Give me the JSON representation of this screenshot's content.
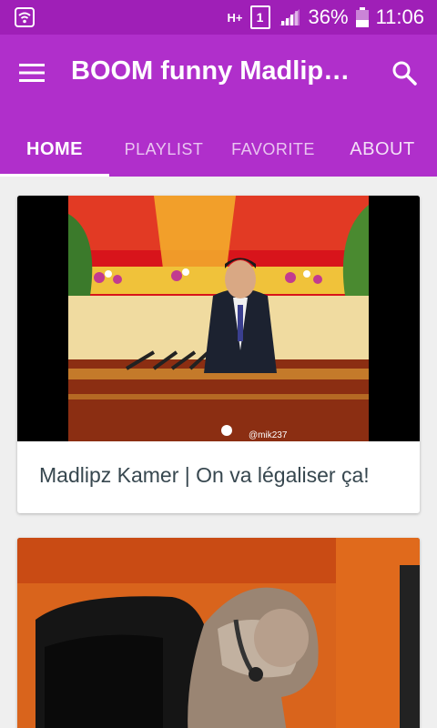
{
  "status_bar": {
    "network": "H+",
    "sim": "1",
    "battery": "36%",
    "time": "11:06"
  },
  "app_bar": {
    "title": "BOOM funny Madlipz…",
    "tabs": [
      {
        "label": "HOME"
      },
      {
        "label": "PLAYLIST"
      },
      {
        "label": "FAVORITE"
      },
      {
        "label": "ABOUT"
      }
    ],
    "active_tab": "HOME",
    "colors": {
      "primary": "#b02fcb",
      "status": "#9f1fb7"
    }
  },
  "videos": [
    {
      "title": "Madlipz Kamer | On va légaliser ça!",
      "watermark": "@mik237"
    },
    {
      "title": ""
    }
  ]
}
